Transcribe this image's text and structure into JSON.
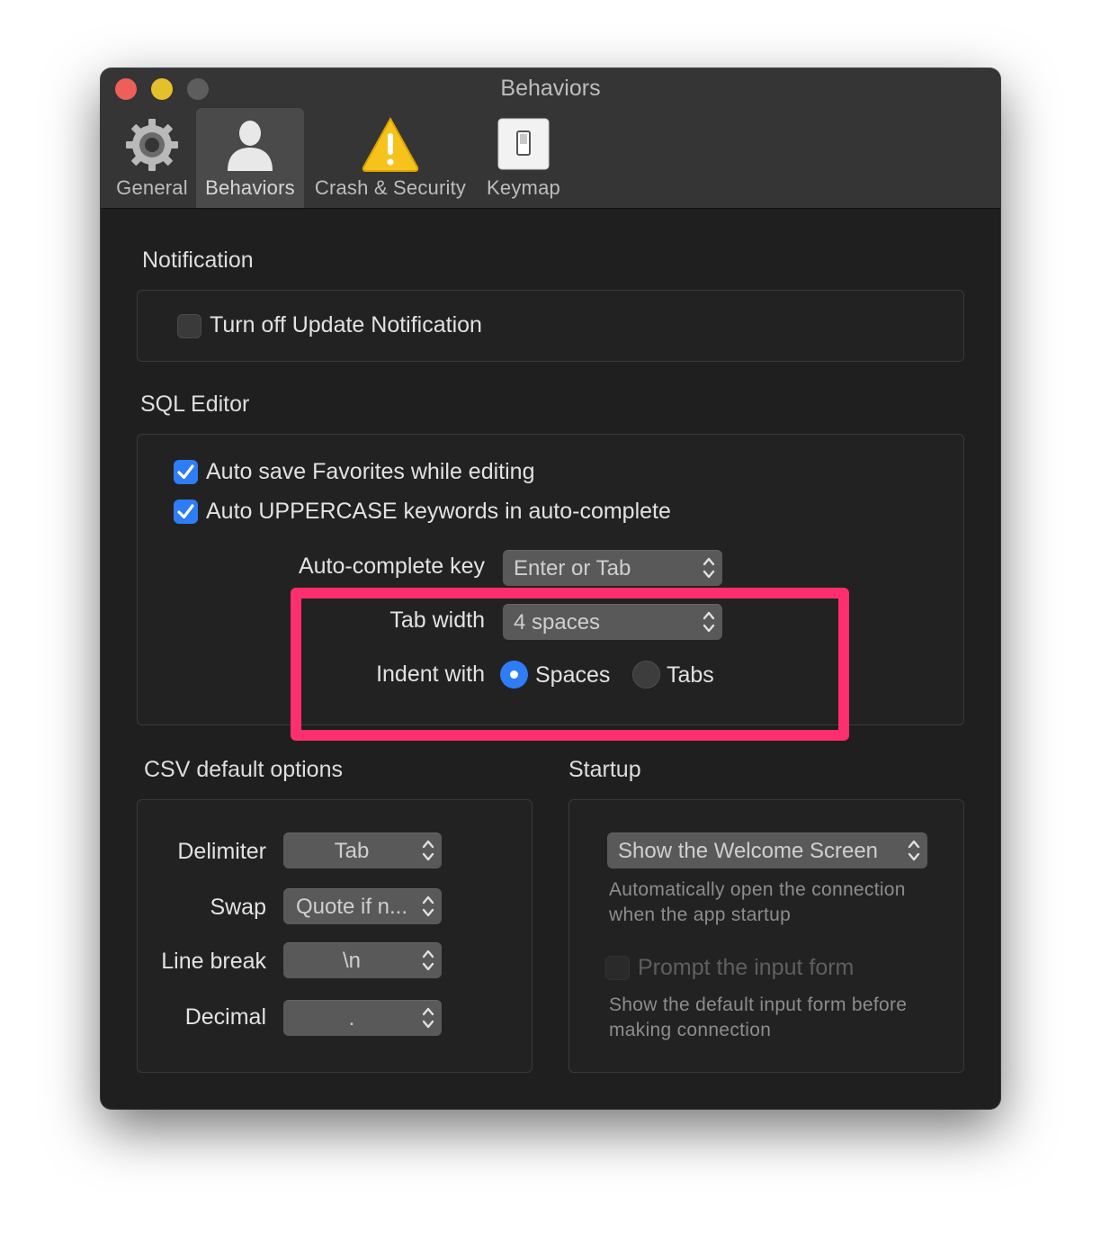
{
  "window": {
    "title": "Behaviors"
  },
  "toolbar": {
    "items": [
      {
        "label": "General",
        "icon": "gear-icon"
      },
      {
        "label": "Behaviors",
        "icon": "person-icon",
        "active": true
      },
      {
        "label": "Crash & Security",
        "icon": "warning-icon"
      },
      {
        "label": "Keymap",
        "icon": "switch-icon"
      }
    ]
  },
  "notification": {
    "title": "Notification",
    "turn_off_update": {
      "label": "Turn off Update Notification",
      "checked": false
    }
  },
  "sql_editor": {
    "title": "SQL Editor",
    "auto_save_favorites": {
      "label": "Auto save Favorites while editing",
      "checked": true
    },
    "auto_uppercase": {
      "label": "Auto UPPERCASE keywords in auto-complete",
      "checked": true
    },
    "autocomplete_key": {
      "label": "Auto-complete key",
      "value": "Enter or Tab"
    },
    "tab_width": {
      "label": "Tab width",
      "value": "4 spaces"
    },
    "indent_with": {
      "label": "Indent with",
      "options": [
        "Spaces",
        "Tabs"
      ],
      "selected": "Spaces"
    }
  },
  "csv": {
    "title": "CSV default options",
    "delimiter": {
      "label": "Delimiter",
      "value": "Tab"
    },
    "swap": {
      "label": "Swap",
      "value": "Quote if n..."
    },
    "line_break": {
      "label": "Line break",
      "value": "\\n"
    },
    "decimal": {
      "label": "Decimal",
      "value": "."
    }
  },
  "startup": {
    "title": "Startup",
    "mode": {
      "value": "Show the Welcome Screen"
    },
    "mode_hint": "Automatically open the connection when the app startup",
    "prompt_input": {
      "label": "Prompt the input form",
      "checked": false,
      "enabled": false
    },
    "prompt_hint": "Show the default input form before making connection"
  },
  "colors": {
    "accent": "#2e7cf6",
    "highlight_border": "#ff2e6e",
    "window_bg": "#1f1f1f",
    "titlebar_bg": "#353535"
  }
}
